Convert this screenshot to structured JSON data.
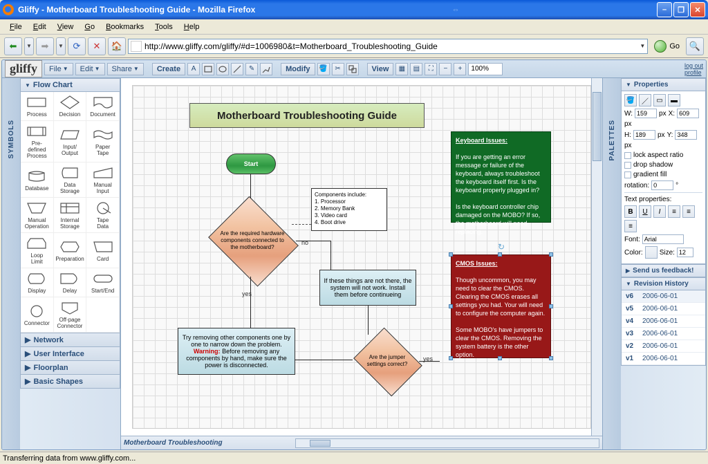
{
  "window": {
    "title": "Gliffy - Motherboard Troubleshooting Guide - Mozilla Firefox",
    "grip": "⇔"
  },
  "browser": {
    "menu": {
      "file": "File",
      "edit": "Edit",
      "view": "View",
      "go": "Go",
      "bookmarks": "Bookmarks",
      "tools": "Tools",
      "help": "Help"
    },
    "url": "http://www.gliffy.com/gliffy/#d=1006980&t=Motherboard_Troubleshooting_Guide",
    "go": "Go",
    "status": "Transferring data from www.gliffy.com..."
  },
  "app": {
    "logo": "gliffy",
    "menus": {
      "file": "File",
      "edit": "Edit",
      "share": "Share"
    },
    "create": "Create",
    "modify": "Modify",
    "view": "View",
    "zoom": "100%",
    "logout": "log out",
    "profile": "profile"
  },
  "symbols_tab": "SYMBOLS",
  "palettes_tab": "PALETTES",
  "palette": {
    "flowchart": "Flow Chart",
    "shapes": [
      {
        "label": "Process"
      },
      {
        "label": "Decision"
      },
      {
        "label": "Document"
      },
      {
        "label": "Pre-\ndefined\nProcess"
      },
      {
        "label": "Input/\nOutput"
      },
      {
        "label": "Paper\nTape"
      },
      {
        "label": "Database"
      },
      {
        "label": "Data\nStorage"
      },
      {
        "label": "Manual\nInput"
      },
      {
        "label": "Manual\nOperation"
      },
      {
        "label": "Internal\nStorage"
      },
      {
        "label": "Tape\nData"
      },
      {
        "label": "Loop\nLimit"
      },
      {
        "label": "Preparation"
      },
      {
        "label": "Card"
      },
      {
        "label": "Display"
      },
      {
        "label": "Delay"
      },
      {
        "label": "Start/End"
      },
      {
        "label": "Connector"
      },
      {
        "label": "Off-page\nConnector"
      },
      {
        "label": ""
      }
    ],
    "sections": [
      "Network",
      "User Interface",
      "Floorplan",
      "Basic Shapes"
    ]
  },
  "canvas": {
    "title": "Motherboard Troubleshooting Guide",
    "start": "Start",
    "d1": "Are the required hardware components connected to the motherboard?",
    "d1_no": "no",
    "d1_yes": "yes",
    "components": "Components include:\n1. Processor\n2. Memory Bank\n3. Video card\n4. Boot drive",
    "install": "If these things are not there, the system will not work.  Install them before continueing",
    "tryremove": "Try removing other components one by one to narrow down the problem.\nWarning:  Before removing any components by hand, make sure the power is disconnected.",
    "d2": "Are the jumper settings correct?",
    "d2_yes": "yes",
    "keyboard": "Keyboard Issues:\n\nIf you are getting an error message or failure of the keyboard, always troubleshoot the keyboard itself first.  Is the keyboard properly plugged in?\n\nIs the keyboard controller chip damaged on the MOBO?  If so, the motherboard will need replacing.",
    "cmos": "CMOS Issues:\n\nThough uncommon, you may need to clear the CMOS.  Clearing the CMOS erases all settings you had.  Your will need to configure the computer again.\n\nSome MOBO's have jumpers to clear the CMOS.  Removing the system battery is the other option.",
    "tab": "Motherboard Troubleshooting"
  },
  "props": {
    "header": "Properties",
    "w": "W:",
    "wval": "159",
    "x": "X:",
    "xval": "609",
    "h": "H:",
    "hval": "189",
    "y": "Y:",
    "yval": "348",
    "px": "px",
    "lock": "lock aspect ratio",
    "drop": "drop shadow",
    "grad": "gradient fill",
    "rotation": "rotation:",
    "rotval": "0",
    "deg": "°",
    "textprops": "Text properties:",
    "font": "Font:",
    "fontval": "Arial",
    "color": "Color:",
    "size": "Size:",
    "sizeval": "12",
    "feedback": "Send us feedback!",
    "history": "Revision History",
    "revisions": [
      {
        "v": "v6",
        "d": "2006-06-01"
      },
      {
        "v": "v5",
        "d": "2006-06-01"
      },
      {
        "v": "v4",
        "d": "2006-06-01"
      },
      {
        "v": "v3",
        "d": "2006-06-01"
      },
      {
        "v": "v2",
        "d": "2006-06-01"
      },
      {
        "v": "v1",
        "d": "2006-06-01"
      }
    ]
  }
}
